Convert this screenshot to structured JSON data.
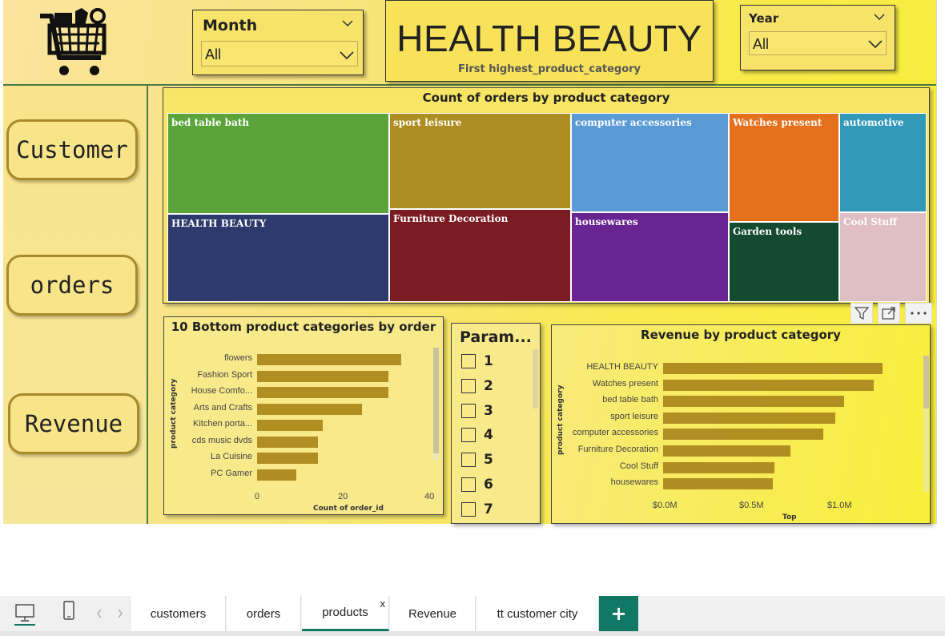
{
  "filters": {
    "month": {
      "title": "Month",
      "value": "All"
    },
    "year": {
      "title": "Year",
      "value": "All"
    }
  },
  "header": {
    "title": "HEALTH BEAUTY",
    "subtitle": "First highest_product_category"
  },
  "nav": {
    "customer": "Customer",
    "orders": "orders",
    "revenue": "Revenue"
  },
  "treemap": {
    "title": "Count of orders by product category",
    "tiles": [
      {
        "label": "bed table bath",
        "color": "#5aa43a"
      },
      {
        "label": "HEALTH BEAUTY",
        "color": "#2e3a6e"
      },
      {
        "label": "sport leisure",
        "color": "#ad8e22"
      },
      {
        "label": "Furniture Decoration",
        "color": "#7a1c22"
      },
      {
        "label": "computer accessories",
        "color": "#5b9bd5"
      },
      {
        "label": "housewares",
        "color": "#682490"
      },
      {
        "label": "Watches present",
        "color": "#e4701c"
      },
      {
        "label": "Garden tools",
        "color": "#134a30"
      },
      {
        "label": "automotive",
        "color": "#3299b8"
      },
      {
        "label": "Cool Stuff",
        "color": "#dfbfc4"
      }
    ]
  },
  "bottom_chart": {
    "title": "10 Bottom product categories by order",
    "ylabel": "product category",
    "xlabel": "Count of order_id",
    "ticks": [
      "0",
      "20",
      "40"
    ]
  },
  "param_slicer": {
    "title": "Param...",
    "items": [
      "1",
      "2",
      "3",
      "4",
      "5",
      "6",
      "7"
    ]
  },
  "revenue_chart": {
    "title": "Revenue by product category",
    "ylabel": "product category",
    "xlabel": "Top",
    "ticks": [
      "$0.0M",
      "$0.5M",
      "$1.0M"
    ]
  },
  "tabs": {
    "items": [
      "customers",
      "orders",
      "products",
      "Revenue",
      "tt customer city"
    ],
    "active": "products",
    "close_glyph": "x",
    "add_glyph": "+"
  },
  "colors": {
    "bar": "#b08e22",
    "accent_green": "#117865",
    "border_gold": "#a88a2a"
  },
  "chart_data": [
    {
      "type": "bar",
      "orientation": "horizontal",
      "title": "10 Bottom product categories by order",
      "xlabel": "Count of order_id",
      "ylabel": "product category",
      "categories": [
        "flowers",
        "Fashion Sport",
        "House Comfo...",
        "Arts and Crafts",
        "Kitchen porta...",
        "cds music dvds",
        "La Cuisine",
        "PC Gamer"
      ],
      "values": [
        33,
        30,
        30,
        24,
        15,
        14,
        14,
        9
      ],
      "xlim": [
        0,
        40
      ],
      "grid": false
    },
    {
      "type": "bar",
      "orientation": "horizontal",
      "title": "Revenue by product category",
      "xlabel": "Top",
      "ylabel": "product category",
      "categories": [
        "HEALTH BEAUTY",
        "Watches present",
        "bed table bath",
        "sport leisure",
        "computer accessories",
        "Furniture Decoration",
        "Cool Stuff",
        "housewares"
      ],
      "values": [
        1.26,
        1.21,
        1.04,
        0.99,
        0.92,
        0.73,
        0.64,
        0.63
      ],
      "unit": "$M",
      "xlim": [
        0,
        1.2
      ],
      "grid": false
    }
  ]
}
